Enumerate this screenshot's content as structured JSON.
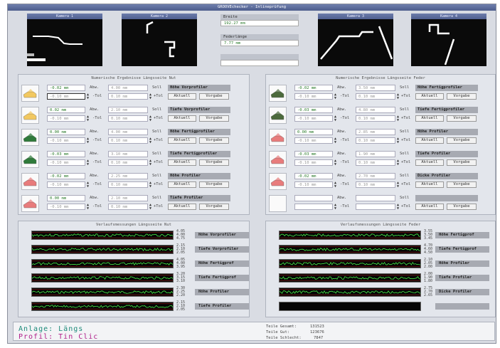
{
  "window": {
    "title": "GROOVEchecker - Inlineprüfung"
  },
  "cameras": [
    "Kamera 1",
    "Kamera 2",
    "Kamera 3",
    "Kamera 4"
  ],
  "measurements": [
    {
      "label": "Breite",
      "value": "192.27 mm"
    },
    {
      "label": "Federlänge",
      "value": "7.77 mm"
    },
    {
      "label": "",
      "value": ""
    }
  ],
  "labels": {
    "abw": "Abw.",
    "soll": "Soll",
    "tol": "-Tol",
    "tolp": "+Tol",
    "aktuell": "Aktuell",
    "vorgabe": "Vorgabe"
  },
  "nut_panel": {
    "title": "Numerische Ergebnisse Längsseite Nut",
    "rows": [
      {
        "ist": "-0.02 mm",
        "soll": "4.00 mm",
        "tol_minus": "-0.10 mm",
        "tol_plus": "0.10 mm",
        "name": "Höhe Vorprofiler",
        "thumb": "profile-yellow-icon",
        "color": "#f2c860"
      },
      {
        "ist": "0.02 mm",
        "soll": "2.10 mm",
        "tol_minus": "-0.10 mm",
        "tol_plus": "0.10 mm",
        "name": "Tiefe Vorprofiler",
        "thumb": "profile-yellow-icon",
        "color": "#f2c860"
      },
      {
        "ist": "0.00 mm",
        "soll": "4.00 mm",
        "tol_minus": "-0.10 mm",
        "tol_plus": "0.10 mm",
        "name": "Höhe Fertigprofiler",
        "thumb": "profile-green-icon",
        "color": "#2f7a3a"
      },
      {
        "ist": "-0.03 mm",
        "soll": "3.10 mm",
        "tol_minus": "-0.10 mm",
        "tol_plus": "0.10 mm",
        "name": "Tiefe Fertigprofiler",
        "thumb": "profile-green-icon",
        "color": "#2f7a3a"
      },
      {
        "ist": "-0.02 mm",
        "soll": "2.25 mm",
        "tol_minus": "-0.10 mm",
        "tol_plus": "0.10 mm",
        "name": "Höhe Profiler",
        "thumb": "profile-red-icon",
        "color": "#e87c7c"
      },
      {
        "ist": "0.00 mm",
        "soll": "2.10 mm",
        "tol_minus": "-0.10 mm",
        "tol_plus": "0.10 mm",
        "name": "Tiefe Profiler",
        "thumb": "profile-red-icon",
        "color": "#e87c7c"
      }
    ]
  },
  "feder_panel": {
    "title": "Numerische Ergebnisse Längsseite Feder",
    "rows": [
      {
        "ist": "-0.02 mm",
        "soll": "3.50 mm",
        "tol_minus": "-0.10 mm",
        "tol_plus": "0.10 mm",
        "name": "Höhe Fertigprofiler",
        "thumb": "profile-dark-icon",
        "color": "#4c6a3c"
      },
      {
        "ist": "-0.03 mm",
        "soll": "4.80 mm",
        "tol_minus": "-0.10 mm",
        "tol_plus": "0.10 mm",
        "name": "Tiefe Fertigprofiler",
        "thumb": "profile-dark-icon",
        "color": "#4c6a3c"
      },
      {
        "ist": "0.00 mm",
        "soll": "2.85 mm",
        "tol_minus": "-0.10 mm",
        "tol_plus": "0.10 mm",
        "name": "Höhe Profiler",
        "thumb": "profile-red-icon",
        "color": "#e87c7c"
      },
      {
        "ist": "-0.03 mm",
        "soll": "1.90 mm",
        "tol_minus": "-0.10 mm",
        "tol_plus": "0.10 mm",
        "name": "Tiefe Profiler",
        "thumb": "profile-red-icon",
        "color": "#e87c7c"
      },
      {
        "ist": "-0.02 mm",
        "soll": "2.70 mm",
        "tol_minus": "-0.10 mm",
        "tol_plus": "0.10 mm",
        "name": "Dicke Profiler",
        "thumb": "profile-red-icon",
        "color": "#e87c7c"
      },
      {
        "ist": "",
        "soll": "",
        "tol_minus": "",
        "tol_plus": "",
        "name": "",
        "thumb": "",
        "color": ""
      }
    ]
  },
  "nut_trend": {
    "title": "Verlaufsmessungen Längsseite Nut",
    "rows": [
      {
        "name": "Höhe Vorprofiler",
        "scale": [
          "4.05",
          "4.00",
          "4.75"
        ]
      },
      {
        "name": "Tiefe Vorprofiler",
        "scale": [
          "2.15",
          "2.10",
          "2.05"
        ]
      },
      {
        "name": "Höhe Fertigprof",
        "scale": [
          "4.05",
          "4.00",
          "3.95"
        ]
      },
      {
        "name": "Tiefe Fertigprof",
        "scale": [
          "3.20",
          "3.15",
          "3.10"
        ]
      },
      {
        "name": "Höhe Profiler",
        "scale": [
          "2.30",
          "2.25",
          "2.20"
        ]
      },
      {
        "name": "Tiefe Profiler",
        "scale": [
          "2.15",
          "2.10",
          "2.05"
        ]
      }
    ]
  },
  "feder_trend": {
    "title": "Verlaufsmessungen Längsseite Feder",
    "rows": [
      {
        "name": "Höhe Fertigprof",
        "scale": [
          "3.55",
          "3.50",
          "3.45"
        ]
      },
      {
        "name": "Tiefe Fertigprof",
        "scale": [
          "4.70",
          "4.60",
          "4.50"
        ]
      },
      {
        "name": "Höhe Profiler",
        "scale": [
          "2.10",
          "2.05",
          "2.00"
        ]
      },
      {
        "name": "Tiefe Profiler",
        "scale": [
          "2.00",
          "1.90",
          "1.80"
        ]
      },
      {
        "name": "Dicke Profiler",
        "scale": [
          "2.75",
          "2.70",
          "2.65"
        ]
      },
      {
        "name": "",
        "scale": [
          "",
          "",
          ""
        ]
      }
    ]
  },
  "status": {
    "anlage": "Anlage: Längs",
    "profil": "Profil: Tin Clic",
    "counters": [
      {
        "label": "Teile Gesamt:",
        "value": "131523"
      },
      {
        "label": "Teile Gut:",
        "value": "123676"
      },
      {
        "label": "Teile Schlecht:",
        "value": "7847"
      }
    ]
  }
}
